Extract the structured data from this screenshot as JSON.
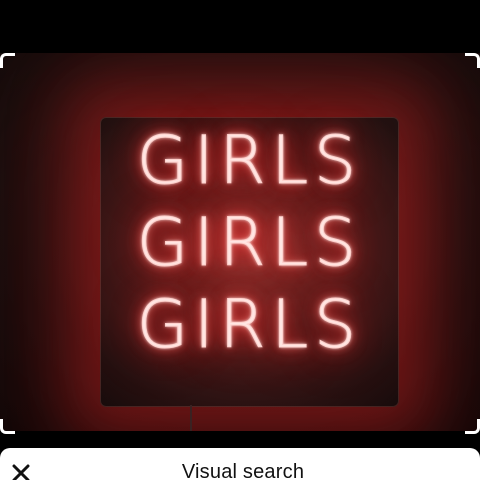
{
  "image": {
    "neon_lines": [
      "GIRLS",
      "GIRLS",
      "GIRLS"
    ],
    "neon_color": "#ff2a2a"
  },
  "bottom_sheet": {
    "title": "Visual search",
    "close_icon": "close-icon"
  },
  "colors": {
    "background": "#000000",
    "sheet": "#ffffff",
    "crop_corners": "#ffffff"
  }
}
